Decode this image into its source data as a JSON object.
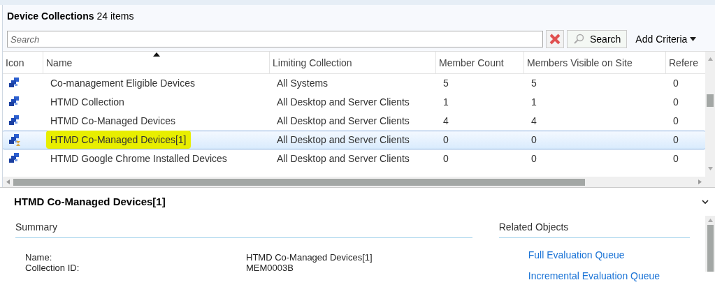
{
  "header": {
    "title": "Device Collections",
    "count": "24 items"
  },
  "search": {
    "placeholder": "Search",
    "button": "Search",
    "criteria": "Add Criteria"
  },
  "table": {
    "columns": [
      {
        "label": "Icon",
        "sorted": false
      },
      {
        "label": "Name",
        "sorted": true
      },
      {
        "label": "Limiting Collection",
        "sorted": false
      },
      {
        "label": "Member Count",
        "sorted": false
      },
      {
        "label": "Members Visible on Site",
        "sorted": false
      },
      {
        "label": "Refere",
        "sorted": false
      }
    ],
    "rows": [
      {
        "kind": "collection",
        "name": "Co-management Eligible Devices",
        "limiting": "All Systems",
        "count": "5",
        "visible": "5",
        "ref": "0",
        "selected": false,
        "highlighted": false
      },
      {
        "kind": "collection",
        "name": "HTMD Collection",
        "limiting": "All Desktop and Server Clients",
        "count": "1",
        "visible": "1",
        "ref": "0",
        "selected": false,
        "highlighted": false
      },
      {
        "kind": "collection",
        "name": "HTMD Co-Managed Devices",
        "limiting": "All Desktop and Server Clients",
        "count": "4",
        "visible": "4",
        "ref": "0",
        "selected": false,
        "highlighted": false
      },
      {
        "kind": "pending",
        "name": "HTMD Co-Managed Devices[1]",
        "limiting": "All Desktop and Server Clients",
        "count": "0",
        "visible": "0",
        "ref": "0",
        "selected": true,
        "highlighted": true
      },
      {
        "kind": "collection",
        "name": "HTMD Google Chrome Installed Devices",
        "limiting": "All Desktop and Server Clients",
        "count": "0",
        "visible": "0",
        "ref": "0",
        "selected": false,
        "highlighted": false
      }
    ]
  },
  "details": {
    "title": "HTMD Co-Managed Devices[1]",
    "summary_heading": "Summary",
    "fields": [
      {
        "label": "Name:",
        "value": "HTMD Co-Managed Devices[1]"
      },
      {
        "label": "Collection ID:",
        "value": "MEM0003B"
      }
    ],
    "related_heading": "Related Objects",
    "links": [
      "Full Evaluation Queue",
      "Incremental Evaluation Queue"
    ]
  }
}
